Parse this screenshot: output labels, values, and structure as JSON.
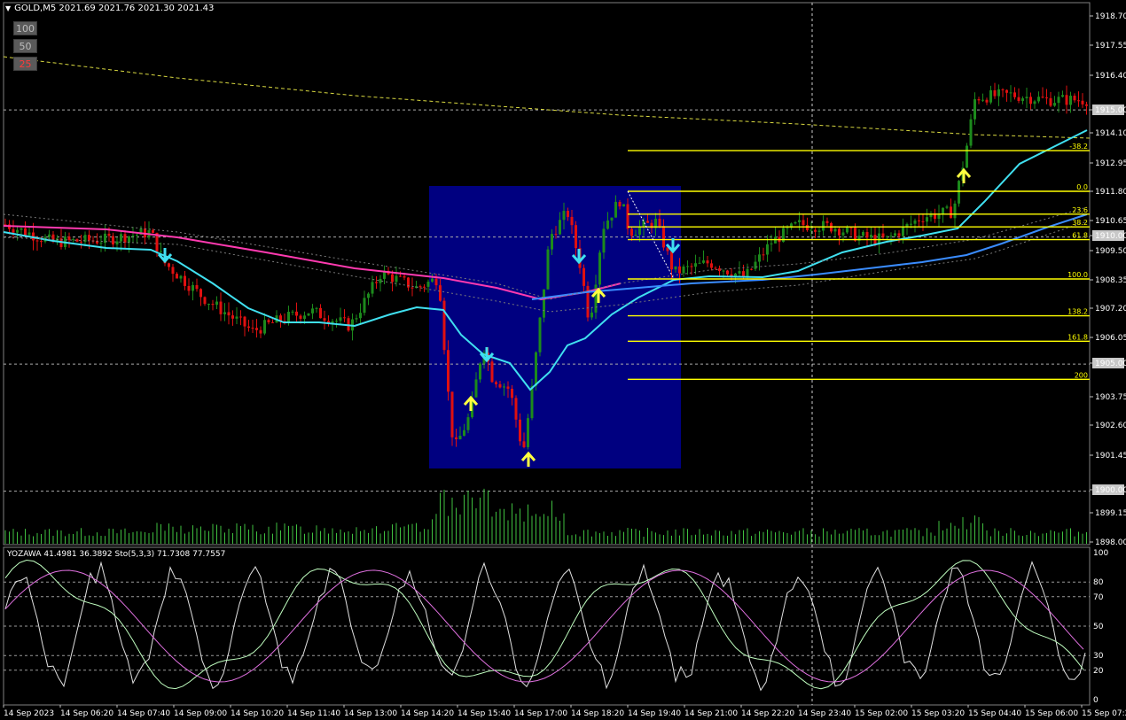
{
  "header": {
    "symbol": "GOLD,M5",
    "ohlc": "2021.69 2021.76 2021.30 2021.43",
    "zoom_buttons": [
      {
        "label": "100",
        "active": false
      },
      {
        "label": "50",
        "active": false
      },
      {
        "label": "25",
        "active": true
      }
    ]
  },
  "oscillator_header": "YOZAWA 41.4981 36.3892  Sto(5,3,3) 71.7308 77.7557",
  "price_axis": [
    "1918.70",
    "1917.55",
    "1916.40",
    "1915.00",
    "1914.10",
    "1912.95",
    "1911.80",
    "1910.65",
    "1910.00",
    "1909.50",
    "1908.35",
    "1907.20",
    "1906.05",
    "1905.00",
    "1903.75",
    "1902.60",
    "1901.45",
    "1900.00",
    "1899.15",
    "1898.00"
  ],
  "highlighted_prices": [
    "1915.00",
    "1910.00",
    "1905.00",
    "1900.00"
  ],
  "osc_axis": [
    "100",
    "80",
    "70",
    "50",
    "30",
    "20",
    "0"
  ],
  "time_axis": [
    "14 Sep 2023",
    "14 Sep 06:20",
    "14 Sep 07:40",
    "14 Sep 09:00",
    "14 Sep 10:20",
    "14 Sep 11:40",
    "14 Sep 13:00",
    "14 Sep 14:20",
    "14 Sep 15:40",
    "14 Sep 17:00",
    "14 Sep 18:20",
    "14 Sep 19:40",
    "14 Sep 21:00",
    "14 Sep 22:20",
    "14 Sep 23:40",
    "15 Sep 02:00",
    "15 Sep 03:20",
    "15 Sep 04:40",
    "15 Sep 06:00",
    "15 Sep 07:20"
  ],
  "fibonacci": {
    "levels": [
      "-38.2",
      "0.0",
      "23.6",
      "38.2",
      "61.8",
      "100.0",
      "138.2",
      "161.8",
      "200"
    ],
    "prices": [
      1913.4,
      1911.8,
      1910.9,
      1910.4,
      1909.9,
      1908.35,
      1906.9,
      1905.9,
      1904.4
    ]
  },
  "colors": {
    "background": "#000000",
    "bull": "#1c8a1c",
    "bear": "#e01010",
    "fib": "#ffff00",
    "highlight_box": "#000080",
    "ma_fast": "#40e0f0",
    "ma_slow": "#ff3ab0",
    "ma_long": "#3a8cff",
    "volume": "#40c040",
    "stoch_main": "#c0ffc0",
    "stoch_signal": "#e070e0",
    "yozawa": "#e0e0e0",
    "arrow_up": "#ffff40",
    "arrow_down": "#40e0f0"
  },
  "icons": {
    "arrow_up": "up-arrow-icon",
    "arrow_down": "down-arrow-icon",
    "dropdown": "triangle-down-icon"
  }
}
